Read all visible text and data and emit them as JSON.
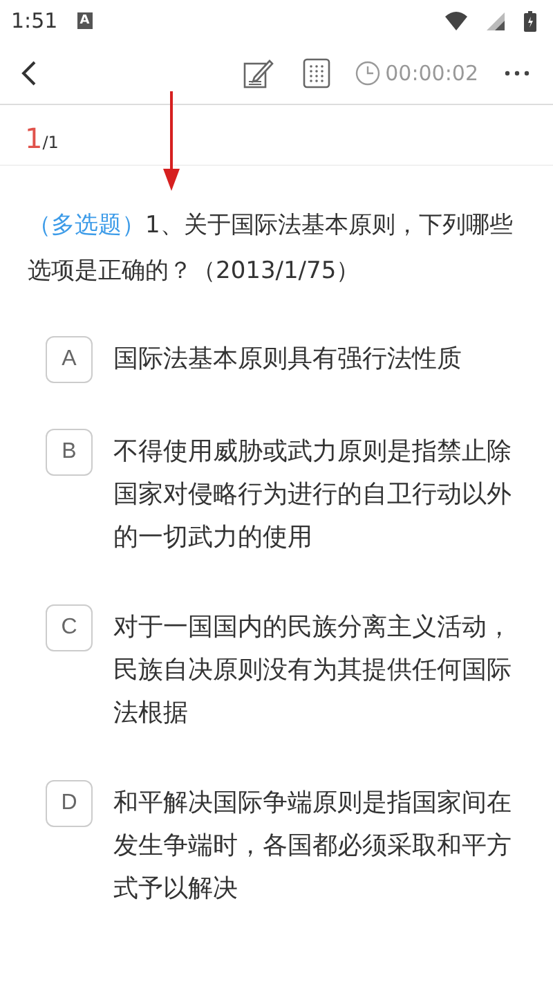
{
  "status_bar": {
    "time": "1:51",
    "notification": "A"
  },
  "toolbar": {
    "timer": "00:00:02"
  },
  "progress": {
    "current": "1",
    "total": "/1"
  },
  "question": {
    "type_label": "（多选题）",
    "text": "1、关于国际法基本原则，下列哪些选项是正确的？（2013/1/75）"
  },
  "options": [
    {
      "letter": "A",
      "text": "国际法基本原则具有强行法性质"
    },
    {
      "letter": "B",
      "text": "不得使用威胁或武力原则是指禁止除国家对侵略行为进行的自卫行动以外的一切武力的使用"
    },
    {
      "letter": "C",
      "text": "对于一国国内的民族分离主义活动，民族自决原则没有为其提供任何国际法根据"
    },
    {
      "letter": "D",
      "text": "和平解决国际争端原则是指国家间在发生争端时，各国都必须采取和平方式予以解决"
    }
  ]
}
